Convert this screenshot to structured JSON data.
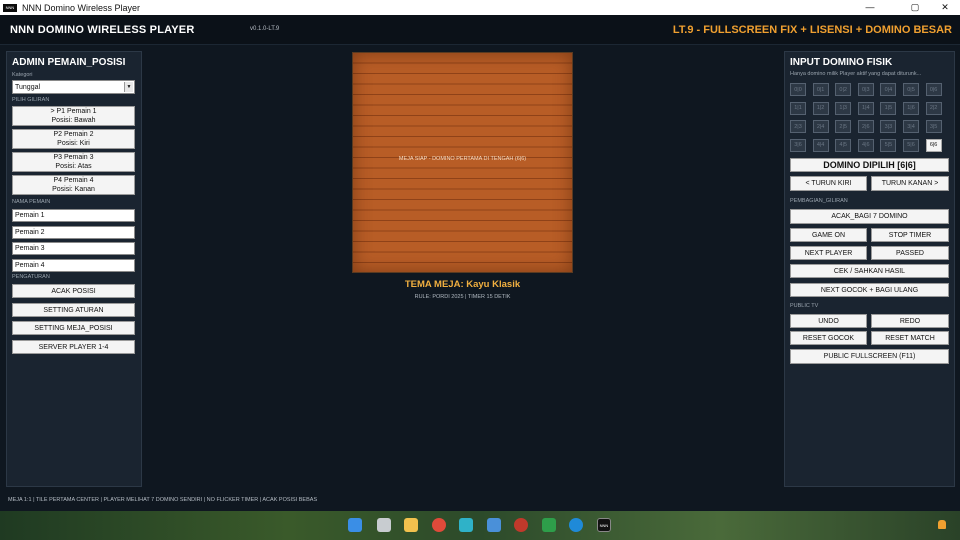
{
  "window": {
    "title": "NNN Domino Wireless Player",
    "app_icon_text": "NNN",
    "minimize": "—",
    "maximize": "▢",
    "close": "✕"
  },
  "header": {
    "title": "NNN DOMINO WIRELESS PLAYER",
    "version": "v0.1.0-LT.9",
    "banner": "LT.9 - FULLSCREEN FIX + LISENSI + DOMINO BESAR"
  },
  "left_panel": {
    "title": "ADMIN PEMAIN_POSISI",
    "category_label": "Kategori",
    "category_value": "Tunggal",
    "turn_label": "PILIH GILIRAN",
    "players": [
      {
        "line1": ">  P1  Pemain 1",
        "line2": "Posisi: Bawah"
      },
      {
        "line1": "P2  Pemain 2",
        "line2": "Posisi: Kiri"
      },
      {
        "line1": "P3  Pemain 3",
        "line2": "Posisi: Atas"
      },
      {
        "line1": "P4  Pemain 4",
        "line2": "Posisi: Kanan"
      }
    ],
    "names_label": "NAMA PEMAIN",
    "names": [
      "Pemain 1",
      "Pemain 2",
      "Pemain 3",
      "Pemain 4"
    ],
    "settings_label": "PENGATURAN",
    "buttons": [
      "ACAK POSISI",
      "SETTING ATURAN",
      "SETTING MEJA_POSISI",
      "SERVER PLAYER 1-4"
    ]
  },
  "center": {
    "table_message": "MEJA SIAP - DOMINO PERTAMA DI TENGAH (6|6)",
    "theme": "TEMA MEJA: Kayu Klasik",
    "rule": "RULE: PORDI 2025  |  TIMER 15 DETIK"
  },
  "right_panel": {
    "title": "INPUT DOMINO FISIK",
    "subtitle": "Hanya domino milik Player aktif yang dapat diturunk...",
    "tiles": [
      "0|0",
      "0|1",
      "0|2",
      "0|3",
      "0|4",
      "0|5",
      "0|6",
      "1|1",
      "1|2",
      "1|3",
      "1|4",
      "1|5",
      "1|6",
      "2|2",
      "2|3",
      "2|4",
      "2|5",
      "2|6",
      "3|3",
      "3|4",
      "3|5",
      "3|6",
      "4|4",
      "4|5",
      "4|6",
      "5|5",
      "5|6",
      "6|6"
    ],
    "active_tile": "6|6",
    "selected": "DOMINO DIPILIH  [6|6]",
    "turn_left": "< TURUN KIRI",
    "turn_right": "TURUN KANAN >",
    "deal_label": "PEMBAGIAN_GILIRAN",
    "deal_button": "ACAK_BAGI 7 DOMINO",
    "game_on": "GAME ON",
    "stop_timer": "STOP TIMER",
    "next_player": "NEXT PLAYER",
    "passed": "PASSED",
    "check_result": "CEK / SAHKAN HASIL",
    "next_gocok": "NEXT GOCOK + BAGI ULANG",
    "public_label": "PUBLIC TV",
    "undo": "UNDO",
    "redo": "REDO",
    "reset_gocok": "RESET GOCOK",
    "reset_match": "RESET MATCH",
    "public_fullscreen": "PUBLIC FULLSCREEN (F11)"
  },
  "footer": {
    "text": "MEJA 1:1  |  TILE PERTAMA CENTER  |  PLAYER MELIHAT 7 DOMINO SENDIRI  |  NO FLICKER TIMER  |  ACAK POSISI BEBAS"
  },
  "taskbar": {
    "app_label": "NNN"
  },
  "colors": {
    "accent": "#f0a030",
    "background": "#0f1720",
    "panel": "#1a2430",
    "table_wood": "#b85d26"
  }
}
